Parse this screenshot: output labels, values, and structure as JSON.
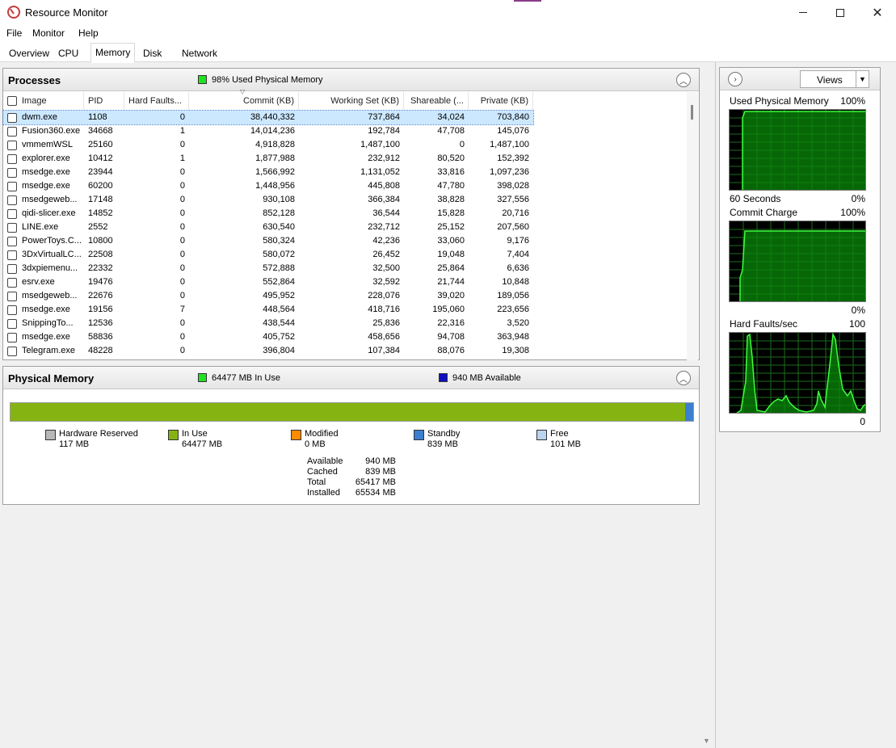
{
  "window": {
    "title": "Resource Monitor"
  },
  "menu": [
    "File",
    "Monitor",
    "Help"
  ],
  "tabs": [
    "Overview",
    "CPU",
    "Memory",
    "Disk",
    "Network"
  ],
  "active_tab": "Memory",
  "processes": {
    "title": "Processes",
    "status": "98% Used Physical Memory",
    "status_color": "#22e022",
    "columns": [
      "Image",
      "PID",
      "Hard Faults...",
      "Commit (KB)",
      "Working Set (KB)",
      "Shareable (...",
      "Private (KB)"
    ],
    "rows": [
      [
        "dwm.exe",
        "1108",
        "0",
        "38,440,332",
        "737,864",
        "34,024",
        "703,840"
      ],
      [
        "Fusion360.exe",
        "34668",
        "1",
        "14,014,236",
        "192,784",
        "47,708",
        "145,076"
      ],
      [
        "vmmemWSL",
        "25160",
        "0",
        "4,918,828",
        "1,487,100",
        "0",
        "1,487,100"
      ],
      [
        "explorer.exe",
        "10412",
        "1",
        "1,877,988",
        "232,912",
        "80,520",
        "152,392"
      ],
      [
        "msedge.exe",
        "23944",
        "0",
        "1,566,992",
        "1,131,052",
        "33,816",
        "1,097,236"
      ],
      [
        "msedge.exe",
        "60200",
        "0",
        "1,448,956",
        "445,808",
        "47,780",
        "398,028"
      ],
      [
        "msedgeweb...",
        "17148",
        "0",
        "930,108",
        "366,384",
        "38,828",
        "327,556"
      ],
      [
        "qidi-slicer.exe",
        "14852",
        "0",
        "852,128",
        "36,544",
        "15,828",
        "20,716"
      ],
      [
        "LINE.exe",
        "2552",
        "0",
        "630,540",
        "232,712",
        "25,152",
        "207,560"
      ],
      [
        "PowerToys.C...",
        "10800",
        "0",
        "580,324",
        "42,236",
        "33,060",
        "9,176"
      ],
      [
        "3DxVirtualLC...",
        "22508",
        "0",
        "580,072",
        "26,452",
        "19,048",
        "7,404"
      ],
      [
        "3dxpiemenu...",
        "22332",
        "0",
        "572,888",
        "32,500",
        "25,864",
        "6,636"
      ],
      [
        "esrv.exe",
        "19476",
        "0",
        "552,864",
        "32,592",
        "21,744",
        "10,848"
      ],
      [
        "msedgeweb...",
        "22676",
        "0",
        "495,952",
        "228,076",
        "39,020",
        "189,056"
      ],
      [
        "msedge.exe",
        "19156",
        "7",
        "448,564",
        "418,716",
        "195,060",
        "223,656"
      ],
      [
        "SnippingTo...",
        "12536",
        "0",
        "438,544",
        "25,836",
        "22,316",
        "3,520"
      ],
      [
        "msedge.exe",
        "58836",
        "0",
        "405,752",
        "458,656",
        "94,708",
        "363,948"
      ],
      [
        "Telegram.exe",
        "48228",
        "0",
        "396,804",
        "107,384",
        "88,076",
        "19,308"
      ]
    ]
  },
  "physical_memory": {
    "title": "Physical Memory",
    "in_use_status": "64477 MB In Use",
    "in_use_color": "#22e022",
    "available_status": "940 MB Available",
    "available_color": "#1010c0",
    "legend": [
      {
        "label": "Hardware Reserved",
        "value": "117 MB",
        "color": "#b8b8b8"
      },
      {
        "label": "In Use",
        "value": "64477 MB",
        "color": "#85b412"
      },
      {
        "label": "Modified",
        "value": "0 MB",
        "color": "#ff8c00"
      },
      {
        "label": "Standby",
        "value": "839 MB",
        "color": "#3b7fd1"
      },
      {
        "label": "Free",
        "value": "101 MB",
        "color": "#b8d4f0"
      }
    ],
    "stats": [
      {
        "label": "Available",
        "value": "940 MB"
      },
      {
        "label": "Cached",
        "value": "839 MB"
      },
      {
        "label": "Total",
        "value": "65417 MB"
      },
      {
        "label": "Installed",
        "value": "65534 MB"
      }
    ]
  },
  "graphs": {
    "views_label": "Views",
    "used_physical": {
      "title": "Used Physical Memory",
      "max": "100%",
      "time": "60 Seconds",
      "min": "0%"
    },
    "commit_charge": {
      "title": "Commit Charge",
      "max": "100%",
      "min": "0%"
    },
    "hard_faults": {
      "title": "Hard Faults/sec",
      "max": "100",
      "min": "0"
    }
  }
}
